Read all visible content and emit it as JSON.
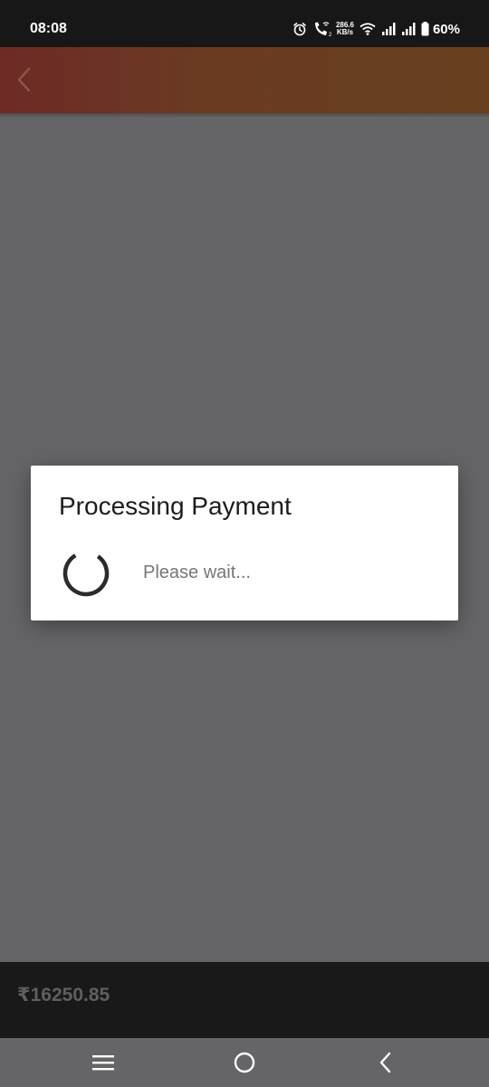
{
  "status_bar": {
    "time": "08:08",
    "net_speed_value": "286.6",
    "net_speed_unit": "KB/s",
    "battery": "60%",
    "icons": [
      "alarm-icon",
      "wifi-call-icon",
      "wifi-icon",
      "signal-icon",
      "signal-icon",
      "battery-icon"
    ]
  },
  "toolbar": {
    "back_icon": "chevron-left-icon"
  },
  "dialog": {
    "title": "Processing Payment",
    "message": "Please wait...",
    "spinner_icon": "loading-spinner-icon"
  },
  "footer": {
    "amount": "₹16250.85"
  },
  "nav": {
    "icons": [
      "recent-apps-icon",
      "home-icon",
      "back-icon"
    ]
  },
  "colors": {
    "overlay": "#656567",
    "toolbar_start": "#6e2a26",
    "toolbar_end": "#68401f",
    "dialog_bg": "#ffffff",
    "footer_bg": "#191919"
  }
}
